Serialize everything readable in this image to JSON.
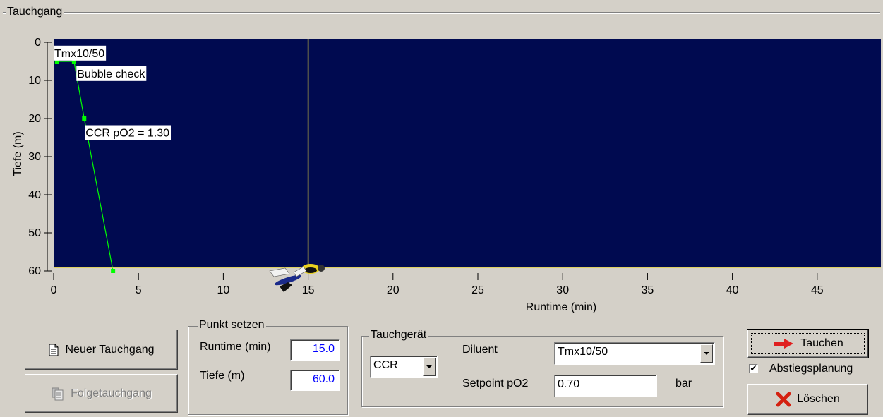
{
  "tauchgang": {
    "group_title": "Tauchgang"
  },
  "chart_data": {
    "type": "line",
    "xlabel": "Runtime (min)",
    "ylabel": "Tiefe (m)",
    "xlim": [
      0,
      49
    ],
    "ylim": [
      0,
      60
    ],
    "y_inverted": true,
    "x_ticks": [
      0,
      5,
      10,
      15,
      20,
      25,
      30,
      35,
      40,
      45
    ],
    "y_ticks": [
      0,
      10,
      20,
      30,
      40,
      50,
      60
    ],
    "background": "#000a50",
    "line_color": "#00ff00",
    "cursor_color": "#e0d040",
    "cursor_runtime": 15,
    "series": [
      {
        "x": [
          0.2,
          1.2,
          1.8,
          3.5
        ],
        "y": [
          5,
          5,
          20,
          60
        ]
      }
    ],
    "annotations": [
      {
        "text": "Tmx10/50",
        "x": 0,
        "y": 2
      },
      {
        "text": "Bubble check",
        "x": 1.3,
        "y": 7
      },
      {
        "text": "CCR pO2 = 1.30",
        "x": 1.8,
        "y": 22.5
      }
    ]
  },
  "buttons": {
    "neuer_tauchgang": "Neuer Tauchgang",
    "folgetauchgang": "Folgetauchgang",
    "tauchen": "Tauchen",
    "loeschen": "Löschen"
  },
  "punkt_setzen": {
    "title": "Punkt setzen",
    "runtime_label": "Runtime (min)",
    "runtime_value": "15.0",
    "tiefe_label": "Tiefe (m)",
    "tiefe_value": "60.0"
  },
  "tauchgeraet": {
    "title": "Tauchgerät",
    "device_value": "CCR",
    "diluent_label": "Diluent",
    "diluent_value": "Tmx10/50",
    "setpoint_label": "Setpoint pO2",
    "setpoint_value": "0.70",
    "setpoint_unit": "bar"
  },
  "abstiegsplanung": {
    "label": "Abstiegsplanung",
    "checked": true,
    "mark": "✔"
  },
  "icons": {
    "new_dive": "document-icon",
    "repetitive_dive": "documents-icon",
    "dive": "arrow-right-icon",
    "delete": "delete-x-icon",
    "diver": "diver-icon"
  }
}
